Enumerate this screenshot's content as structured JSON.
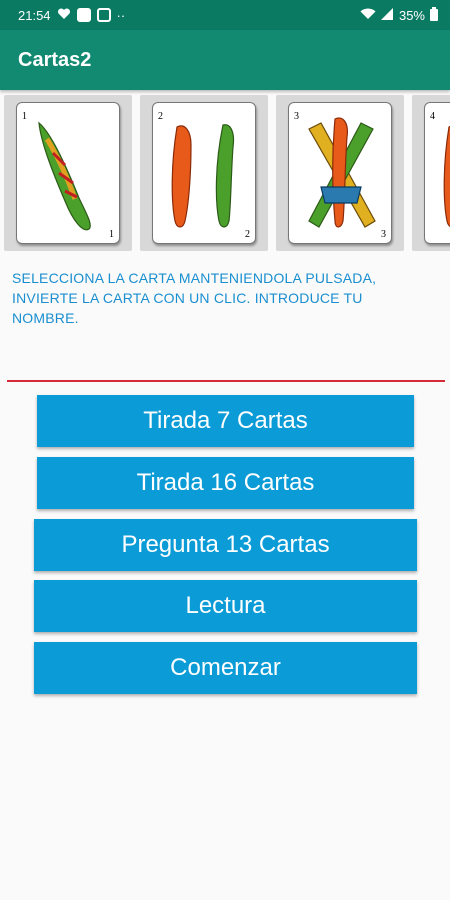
{
  "status_bar": {
    "time": "21:54",
    "battery": "35%"
  },
  "app_bar": {
    "title": "Cartas2"
  },
  "cards": [
    {
      "suit_icon": "club-card-icon",
      "rank": "1"
    },
    {
      "suit_icon": "club-card-icon",
      "rank": "2"
    },
    {
      "suit_icon": "club-card-icon",
      "rank": "3"
    },
    {
      "suit_icon": "club-card-icon",
      "rank": "4"
    }
  ],
  "instructions": "SELECCIONA LA CARTA MANTENIENDOLA PULSADA, INVIERTE LA CARTA CON UN CLIC. INTRODUCE TU NOMBRE.",
  "name_input": {
    "value": "",
    "placeholder": ""
  },
  "buttons": {
    "tirada7": "Tirada 7 Cartas",
    "tirada16": "Tirada 16 Cartas",
    "pregunta13": "Pregunta 13 Cartas",
    "lectura": "Lectura",
    "comenzar": "Comenzar"
  },
  "colors": {
    "status_bar": "#0a7a63",
    "app_bar": "#128a72",
    "button": "#0b9bd6",
    "instruction_text": "#1a8fd0",
    "input_underline": "#d62a37"
  }
}
